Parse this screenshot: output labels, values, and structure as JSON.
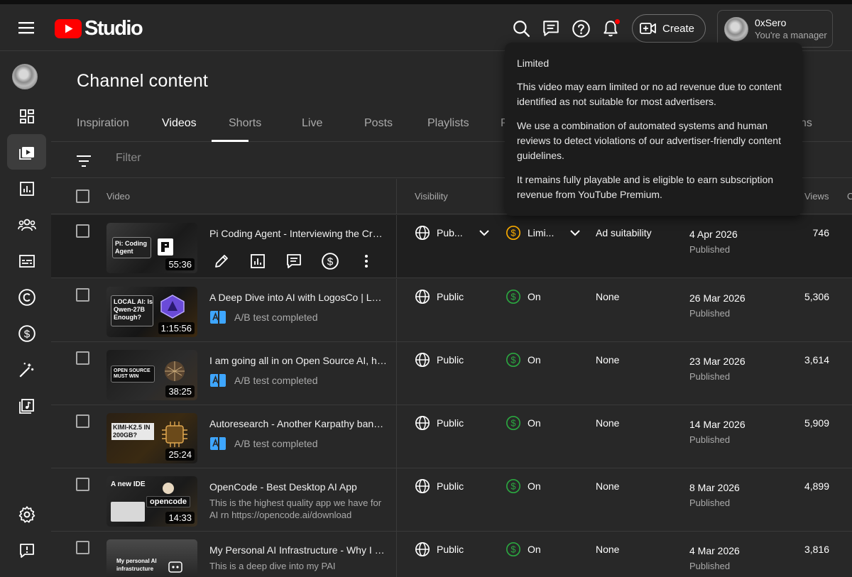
{
  "app": {
    "name": "Studio"
  },
  "header": {
    "create_label": "Create",
    "account_name": "0xSero",
    "account_role": "You're a manager"
  },
  "page": {
    "title": "Channel content"
  },
  "tabs": [
    "Inspiration",
    "Videos",
    "Shorts",
    "Live",
    "Posts",
    "Playlists",
    "P",
    "ns"
  ],
  "active_tab": "Videos",
  "filter": {
    "placeholder": "Filter"
  },
  "columns": {
    "video": "Video",
    "visibility": "Visibility",
    "views": "Views",
    "cut": "C"
  },
  "tooltip": {
    "title": "Limited",
    "p1": "This video may earn limited or no ad revenue due to content identified as not suitable for most advertisers.",
    "p2": "We use a combination of automated systems and human reviews to detect violations of our advertiser-friendly content guidelines.",
    "p3": "It remains fully playable and is eligible to earn subscription revenue from YouTube Premium."
  },
  "rows": [
    {
      "title": "Pi Coding Agent - Interviewing the Creator of Pi",
      "duration": "55:36",
      "thumb_text": "Pi: Coding Agent",
      "visibility": "Pub...",
      "monetization": "Limi...",
      "restrictions": "Ad suitability",
      "date": "4 Apr 2026",
      "status": "Published",
      "views": "746"
    },
    {
      "title": "A Deep Dive into AI with LogosCo | LogosCo",
      "duration": "1:15:56",
      "thumb_text": "LOCAL AI: Is Qwen-27B Enough?",
      "sub_text": "A/B test completed",
      "visibility": "Public",
      "monetization": "On",
      "restrictions": "None",
      "date": "26 Mar 2026",
      "status": "Published",
      "views": "5,306"
    },
    {
      "title": "I am going all in on Open Source AI, here's why",
      "duration": "38:25",
      "thumb_text": "OPEN SOURCE MUST WIN",
      "sub_text": "A/B test completed",
      "visibility": "Public",
      "monetization": "On",
      "restrictions": "None",
      "date": "23 Mar 2026",
      "status": "Published",
      "views": "3,614"
    },
    {
      "title": "Autoresearch - Another Karpathy banger",
      "duration": "25:24",
      "thumb_text": "KIMI-K2.5 IN 200GB?",
      "sub_text": "A/B test completed",
      "visibility": "Public",
      "monetization": "On",
      "restrictions": "None",
      "date": "14 Mar 2026",
      "status": "Published",
      "views": "5,909"
    },
    {
      "title": "OpenCode - Best Desktop AI App",
      "duration": "14:33",
      "thumb_text": "A new IDE",
      "description": "This is the highest quality app we have for AI rn https://opencode.ai/download",
      "visibility": "Public",
      "monetization": "On",
      "restrictions": "None",
      "date": "8 Mar 2026",
      "status": "Published",
      "views": "4,899"
    },
    {
      "title": "My Personal AI Infrastructure - Why I chose this",
      "duration": "",
      "thumb_text": "My personal AI infrastructure",
      "description": "This is a deep dive into my PAI",
      "visibility": "Public",
      "monetization": "On",
      "restrictions": "None",
      "date": "4 Mar 2026",
      "status": "Published",
      "views": "3,816"
    }
  ],
  "colors": {
    "brand_red": "#ff0000",
    "monetized_green": "#2ba640",
    "limited_yellow": "#f9ab00",
    "ab_blue": "#3ea6ff"
  }
}
